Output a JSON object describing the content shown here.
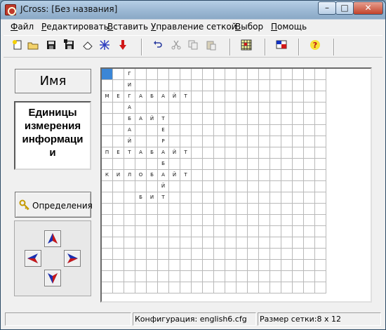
{
  "window": {
    "title": "JCross: [Без названия]"
  },
  "menu": {
    "items": [
      {
        "first": "Ф",
        "rest": "айл"
      },
      {
        "first": "Р",
        "rest": "едактировать"
      },
      {
        "first": "В",
        "rest": "ставить"
      },
      {
        "first": "У",
        "rest": "правление сеткой"
      },
      {
        "first": "В",
        "rest": "ыбор"
      },
      {
        "first": "П",
        "rest": "омощь"
      }
    ]
  },
  "toolbar": {
    "icons": [
      "new-file-icon",
      "open-folder-icon",
      "save-icon",
      "save-as-icon",
      "eraser-icon",
      "pattern-icon",
      "down-arrow-icon",
      "undo-icon",
      "cut-icon",
      "copy-icon",
      "paste-icon",
      "grid-icon",
      "flag-icon",
      "help-icon"
    ]
  },
  "left_panel": {
    "name_button": "Имя",
    "topic_lines": [
      "Единицы",
      "измерения",
      "информаци",
      "и"
    ],
    "definitions_button": "Определения"
  },
  "grid": {
    "cols": 20,
    "rows": 20,
    "selected": [
      0,
      0
    ],
    "letters": [
      {
        "r": 0,
        "c": 2,
        "ch": "Г"
      },
      {
        "r": 1,
        "c": 2,
        "ch": "И"
      },
      {
        "r": 2,
        "c": 0,
        "ch": "М"
      },
      {
        "r": 2,
        "c": 1,
        "ch": "Е"
      },
      {
        "r": 2,
        "c": 2,
        "ch": "Г"
      },
      {
        "r": 2,
        "c": 3,
        "ch": "А"
      },
      {
        "r": 2,
        "c": 4,
        "ch": "Б"
      },
      {
        "r": 2,
        "c": 5,
        "ch": "А"
      },
      {
        "r": 2,
        "c": 6,
        "ch": "Й"
      },
      {
        "r": 2,
        "c": 7,
        "ch": "Т"
      },
      {
        "r": 3,
        "c": 2,
        "ch": "А"
      },
      {
        "r": 4,
        "c": 2,
        "ch": "Б"
      },
      {
        "r": 4,
        "c": 3,
        "ch": "А"
      },
      {
        "r": 4,
        "c": 4,
        "ch": "Й"
      },
      {
        "r": 4,
        "c": 5,
        "ch": "Т"
      },
      {
        "r": 5,
        "c": 2,
        "ch": "А"
      },
      {
        "r": 5,
        "c": 5,
        "ch": "Е"
      },
      {
        "r": 6,
        "c": 2,
        "ch": "Й"
      },
      {
        "r": 6,
        "c": 5,
        "ch": "Р"
      },
      {
        "r": 7,
        "c": 0,
        "ch": "П"
      },
      {
        "r": 7,
        "c": 1,
        "ch": "Е"
      },
      {
        "r": 7,
        "c": 2,
        "ch": "Т"
      },
      {
        "r": 7,
        "c": 3,
        "ch": "А"
      },
      {
        "r": 7,
        "c": 4,
        "ch": "Б"
      },
      {
        "r": 7,
        "c": 5,
        "ch": "А"
      },
      {
        "r": 7,
        "c": 6,
        "ch": "Й"
      },
      {
        "r": 7,
        "c": 7,
        "ch": "Т"
      },
      {
        "r": 8,
        "c": 5,
        "ch": "Б"
      },
      {
        "r": 9,
        "c": 0,
        "ch": "К"
      },
      {
        "r": 9,
        "c": 1,
        "ch": "И"
      },
      {
        "r": 9,
        "c": 2,
        "ch": "Л"
      },
      {
        "r": 9,
        "c": 3,
        "ch": "О"
      },
      {
        "r": 9,
        "c": 4,
        "ch": "Б"
      },
      {
        "r": 9,
        "c": 5,
        "ch": "А"
      },
      {
        "r": 9,
        "c": 6,
        "ch": "Й"
      },
      {
        "r": 9,
        "c": 7,
        "ch": "Т"
      },
      {
        "r": 10,
        "c": 5,
        "ch": "Й"
      },
      {
        "r": 11,
        "c": 3,
        "ch": "Б"
      },
      {
        "r": 11,
        "c": 4,
        "ch": "И"
      },
      {
        "r": 11,
        "c": 5,
        "ch": "Т"
      }
    ]
  },
  "status": {
    "config": "Конфигурация: english6.cfg",
    "grid_size": "Размер сетки:8 x 12"
  },
  "colors": {
    "selected_cell": "#3b86d6",
    "arrow_blue": "#1a2fb0",
    "arrow_red": "#c81818"
  }
}
